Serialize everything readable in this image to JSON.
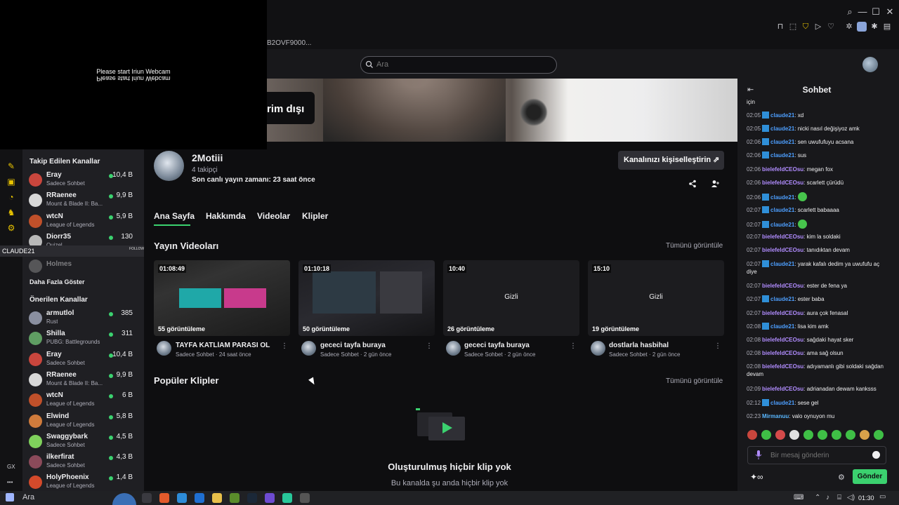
{
  "browser": {
    "url_trail": "B2OVF9000..."
  },
  "webcam": {
    "message": "Please start Iriun Webcam",
    "message_mirrored": "Please start Iriun Webcam"
  },
  "header": {
    "search_placeholder": "Ara"
  },
  "banner": {
    "offline_text": "rim dışı"
  },
  "sidebar": {
    "followed_title": "Takip Edilen Kanallar",
    "followed": [
      {
        "name": "Eray",
        "game": "Sadece Sohbet",
        "viewers": "10,4 B",
        "avatar_color": "#c9463d"
      },
      {
        "name": "RRaenee",
        "game": "Mount & Blade II: Ba...",
        "viewers": "9,9 B",
        "avatar_color": "#d8d8d8"
      },
      {
        "name": "wtcN",
        "game": "League of Legends",
        "viewers": "5,9 B",
        "avatar_color": "#c0502a"
      },
      {
        "name": "Diorr35",
        "game": "Quizel",
        "viewers": "130",
        "avatar_color": "#b9b9b9"
      }
    ],
    "overlay_label": "CLAUDE21",
    "overlay_follow": "FOLLOW",
    "offline_channel": "Holmes",
    "show_more": "Daha Fazla Göster",
    "recommended_title": "Önerilen Kanallar",
    "recommended": [
      {
        "name": "armutlol",
        "game": "Rust",
        "viewers": "385",
        "avatar_color": "#8a8fa0"
      },
      {
        "name": "Shilla",
        "game": "PUBG: Battlegrounds",
        "viewers": "311",
        "avatar_color": "#5f9e63"
      },
      {
        "name": "Eray",
        "game": "Sadece Sohbet",
        "viewers": "10,4 B",
        "avatar_color": "#c9463d"
      },
      {
        "name": "RRaenee",
        "game": "Mount & Blade II: Ba...",
        "viewers": "9,9 B",
        "avatar_color": "#d8d8d8"
      },
      {
        "name": "wtcN",
        "game": "League of Legends",
        "viewers": "6 B",
        "avatar_color": "#c0502a"
      },
      {
        "name": "Elwind",
        "game": "League of Legends",
        "viewers": "5,8 B",
        "avatar_color": "#d07b3c"
      },
      {
        "name": "Swaggybark",
        "game": "Sadece Sohbet",
        "viewers": "4,5 B",
        "avatar_color": "#7fd15c"
      },
      {
        "name": "ilkerfirat",
        "game": "Sadece Sohbet",
        "viewers": "4,3 B",
        "avatar_color": "#8b4a5a"
      },
      {
        "name": "HolyPhoenix",
        "game": "League of Legends",
        "viewers": "1,4 B",
        "avatar_color": "#d44a2b"
      }
    ],
    "gx_label": "GX"
  },
  "channel": {
    "name": "2Motiii",
    "followers": "4 takipçi",
    "last_live": "Son canlı yayın zamanı: 23 saat önce",
    "customize_label": "Kanalınızı kişiselleştirin ⇗"
  },
  "tabs": [
    "Ana Sayfa",
    "Hakkımda",
    "Videolar",
    "Klipler"
  ],
  "videos_section": {
    "title": "Yayın Videoları",
    "see_all": "Tümünü görüntüle"
  },
  "videos": [
    {
      "length": "01:08:49",
      "views": "55 görüntüleme",
      "title": "TAYFA KATLİAM PARASI OL...",
      "meta": "Sadece Sohbet · 24 saat önce",
      "hidden": ""
    },
    {
      "length": "01:10:18",
      "views": "50 görüntüleme",
      "title": "gececi tayfa buraya",
      "meta": "Sadece Sohbet · 2 gün önce",
      "hidden": ""
    },
    {
      "length": "10:40",
      "views": "26 görüntüleme",
      "title": "gececi tayfa buraya",
      "meta": "Sadece Sohbet · 2 gün önce",
      "hidden": "Gizli"
    },
    {
      "length": "15:10",
      "views": "19 görüntüleme",
      "title": "dostlarla hasbihal",
      "meta": "Sadece Sohbet · 2 gün önce",
      "hidden": "Gizli"
    }
  ],
  "clips_section": {
    "title": "Popüler Klipler",
    "see_all": "Tümünü görüntüle",
    "empty_title": "Oluşturulmuş hiçbir klip yok",
    "empty_sub": "Bu kanalda şu anda hiçbir klip yok"
  },
  "chat": {
    "title": "Sohbet",
    "scroll_top_text": "için",
    "messages": [
      {
        "time": "02:05",
        "user": "claude21",
        "text": ": xd",
        "badge": true
      },
      {
        "time": "02:05",
        "user": "claude21",
        "text": ": nicki nasıl değişiyoz amk",
        "badge": true
      },
      {
        "time": "02:06",
        "user": "claude21",
        "text": ": sen uwufufuyu acsana",
        "badge": true
      },
      {
        "time": "02:06",
        "user": "claude21",
        "text": ": sus",
        "badge": true
      },
      {
        "time": "02:06",
        "user": "bielefeldCEOsu",
        "text": ": megan fox",
        "badge": false
      },
      {
        "time": "02:06",
        "user": "bielefeldCEOsu",
        "text": ": scarlett çürüdü",
        "badge": false
      },
      {
        "time": "02:06",
        "user": "claude21",
        "text": ":",
        "badge": true,
        "emote": true
      },
      {
        "time": "02:07",
        "user": "claude21",
        "text": ": scarlett babaaaa",
        "badge": true
      },
      {
        "time": "02:07",
        "user": "claude21",
        "text": ":",
        "badge": true,
        "emote": true
      },
      {
        "time": "02:07",
        "user": "bielefeldCEOsu",
        "text": ": kim la soldaki",
        "badge": false
      },
      {
        "time": "02:07",
        "user": "bielefeldCEOsu",
        "text": ": tanıdıktan devam",
        "badge": false
      },
      {
        "time": "02:07",
        "user": "claude21",
        "text": ": yarak kafalı dedim ya uwufufu aç diye",
        "badge": true
      },
      {
        "time": "02:07",
        "user": "bielefeldCEOsu",
        "text": ": ester de fena ya",
        "badge": false
      },
      {
        "time": "02:07",
        "user": "claude21",
        "text": ": ester baba",
        "badge": true
      },
      {
        "time": "02:07",
        "user": "bielefeldCEOsu",
        "text": ": aura çok fenasal",
        "badge": false
      },
      {
        "time": "02:08",
        "user": "claude21",
        "text": ": lisa kim amk",
        "badge": true
      },
      {
        "time": "02:08",
        "user": "bielefeldCEOsu",
        "text": ": sağdaki hayat sker",
        "badge": false
      },
      {
        "time": "02:08",
        "user": "bielefeldCEOsu",
        "text": ": ama sağ olsun",
        "badge": false
      },
      {
        "time": "02:08",
        "user": "bielefeldCEOsu",
        "text": ": adıyamanlı gibi soldaki sağdan devam",
        "badge": false
      },
      {
        "time": "02:09",
        "user": "bielefeldCEOsu",
        "text": ": adrianadan dewam kanksss",
        "badge": false
      },
      {
        "time": "02:12",
        "user": "claude21",
        "text": ": sese gel",
        "badge": true
      },
      {
        "time": "02:23",
        "user": "Mirmanuu",
        "text": ": valo oynuyon mu",
        "badge": false
      }
    ],
    "input_placeholder": "Bir mesaj gönderin",
    "send_label": "Gönder",
    "points_label": "✦∞"
  },
  "taskbar": {
    "search_label": "Ara",
    "time": "01:30"
  },
  "colors": {
    "accent": "#3bd16f",
    "chat_user_blue": "#4d9fff",
    "chat_user_purple": "#b18cff"
  }
}
